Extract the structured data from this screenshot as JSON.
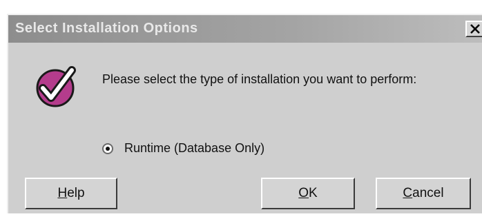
{
  "window": {
    "title": "Select Installation Options",
    "close_glyph": "×"
  },
  "content": {
    "prompt": "Please select the type of installation you want to perform:",
    "option": {
      "label": "Runtime (Database Only)",
      "selected": true
    }
  },
  "buttons": {
    "help": {
      "accel": "H",
      "rest": "elp"
    },
    "ok": {
      "accel": "O",
      "rest": "K"
    },
    "cancel": {
      "accel": "C",
      "rest": "ancel"
    }
  },
  "icons": {
    "installer": "check-badge-icon"
  },
  "colors": {
    "title_bar": "#9a9a9a",
    "dialog_bg": "#cfcfcf",
    "icon_fill": "#b43c8c"
  }
}
